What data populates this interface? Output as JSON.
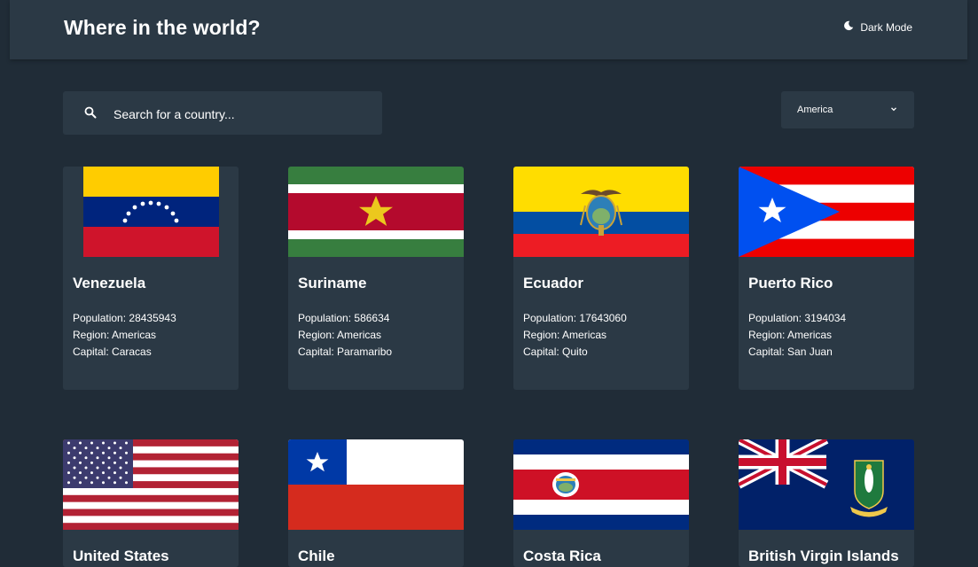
{
  "header": {
    "title": "Where in the world?",
    "dark_mode_label": "Dark Mode"
  },
  "search": {
    "placeholder": "Search for a country..."
  },
  "filter": {
    "selected": "America"
  },
  "labels": {
    "population": "Population:",
    "region": "Region:",
    "capital": "Capital:"
  },
  "countries": [
    {
      "name": "Venezuela",
      "population": "28435943",
      "region": "Americas",
      "capital": "Caracas"
    },
    {
      "name": "Suriname",
      "population": "586634",
      "region": "Americas",
      "capital": "Paramaribo"
    },
    {
      "name": "Ecuador",
      "population": "17643060",
      "region": "Americas",
      "capital": "Quito"
    },
    {
      "name": "Puerto Rico",
      "population": "3194034",
      "region": "Americas",
      "capital": "San Juan"
    },
    {
      "name": "United States"
    },
    {
      "name": "Chile"
    },
    {
      "name": "Costa Rica"
    },
    {
      "name": "British Virgin Islands"
    }
  ],
  "colors": {
    "background": "#202c37",
    "element": "#2b3945",
    "text": "#ffffff"
  }
}
